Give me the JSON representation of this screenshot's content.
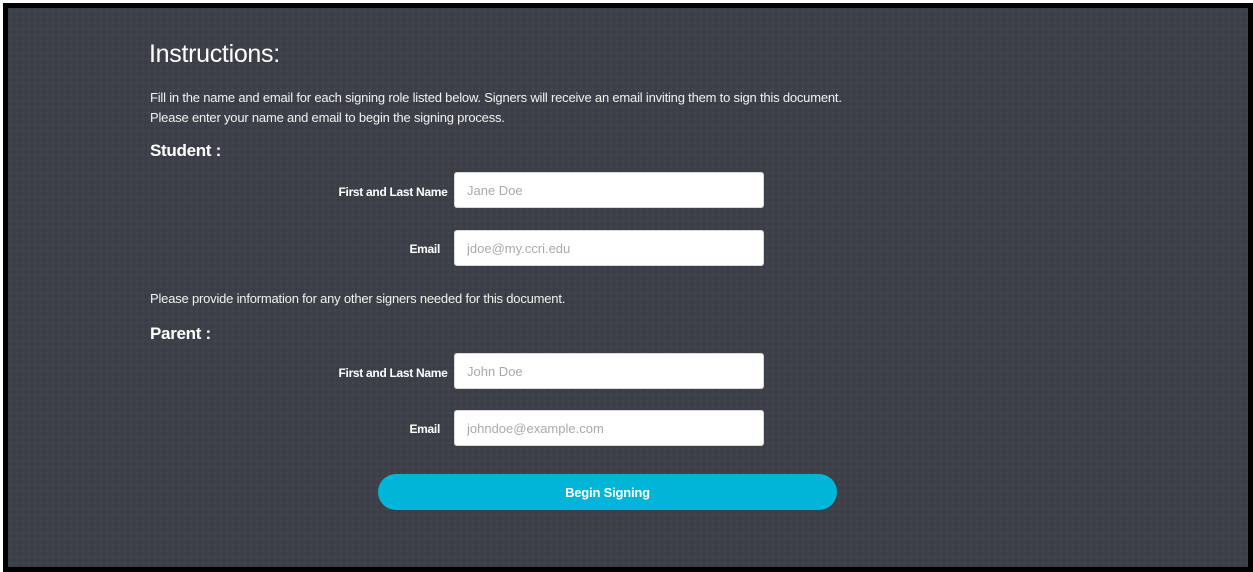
{
  "heading": "Instructions:",
  "instructions": [
    "Fill in the name and email for each signing role listed below. Signers will receive an email inviting them to sign this document.",
    "Please enter your name and email to begin the signing process."
  ],
  "student": {
    "role_label": "Student :",
    "name_label": "First and Last Name",
    "name_placeholder": "Jane Doe",
    "email_label": "Email",
    "email_placeholder": "jdoe@my.ccri.edu"
  },
  "other_signers_note": "Please provide information for any other signers needed for this document.",
  "parent": {
    "role_label": "Parent :",
    "name_label": "First and Last Name",
    "name_placeholder": "John Doe",
    "email_label": "Email",
    "email_placeholder": "johndoe@example.com"
  },
  "submit_label": "Begin Signing",
  "colors": {
    "background": "#3d4048",
    "border": "#000000",
    "button": "#00b5d8",
    "text": "#ffffff"
  }
}
